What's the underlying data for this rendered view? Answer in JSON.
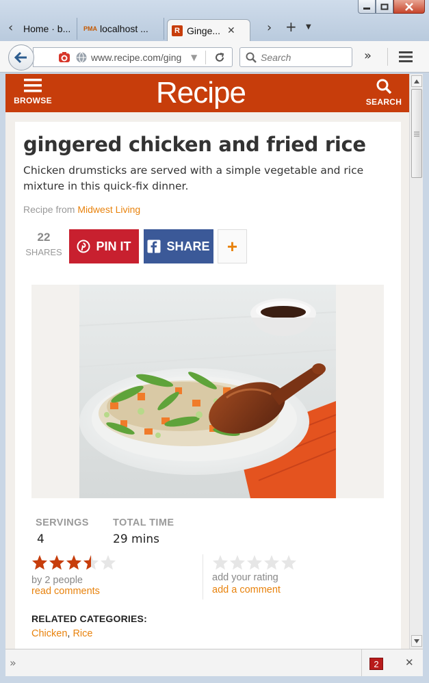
{
  "browser": {
    "tabs": [
      {
        "label": "Home · b..."
      },
      {
        "label": "localhost ..."
      },
      {
        "label": "Ginge..."
      }
    ],
    "url": "www.recipe.com/ging",
    "search_placeholder": "Search",
    "bottom_badge": "2"
  },
  "site": {
    "logo": "Recipe",
    "browse_label": "BROWSE",
    "search_label": "SEARCH",
    "accent_color": "#c73d0b"
  },
  "recipe": {
    "title": "gingered chicken and fried rice",
    "description": "Chicken drumsticks are served with a simple vegetable and rice mixture in this quick-fix dinner.",
    "source_prefix": "Recipe from ",
    "source_name": "Midwest Living",
    "shares_count": "22",
    "shares_label": "SHARES",
    "pin_label": "PIN IT",
    "share_label": "SHARE",
    "plus_label": "+",
    "servings_label": "SERVINGS",
    "servings_value": "4",
    "total_time_label": "TOTAL TIME",
    "total_time_value": "29 mins",
    "rating_value": 3.5,
    "rating_max": 5,
    "rating_by": "by 2  people",
    "read_comments": "read comments",
    "your_rating_label": "add your rating",
    "add_comment": "add a comment",
    "related_heading": "RELATED CATEGORIES:",
    "related_categories": [
      "Chicken",
      "Rice"
    ],
    "related_separator": ", "
  }
}
